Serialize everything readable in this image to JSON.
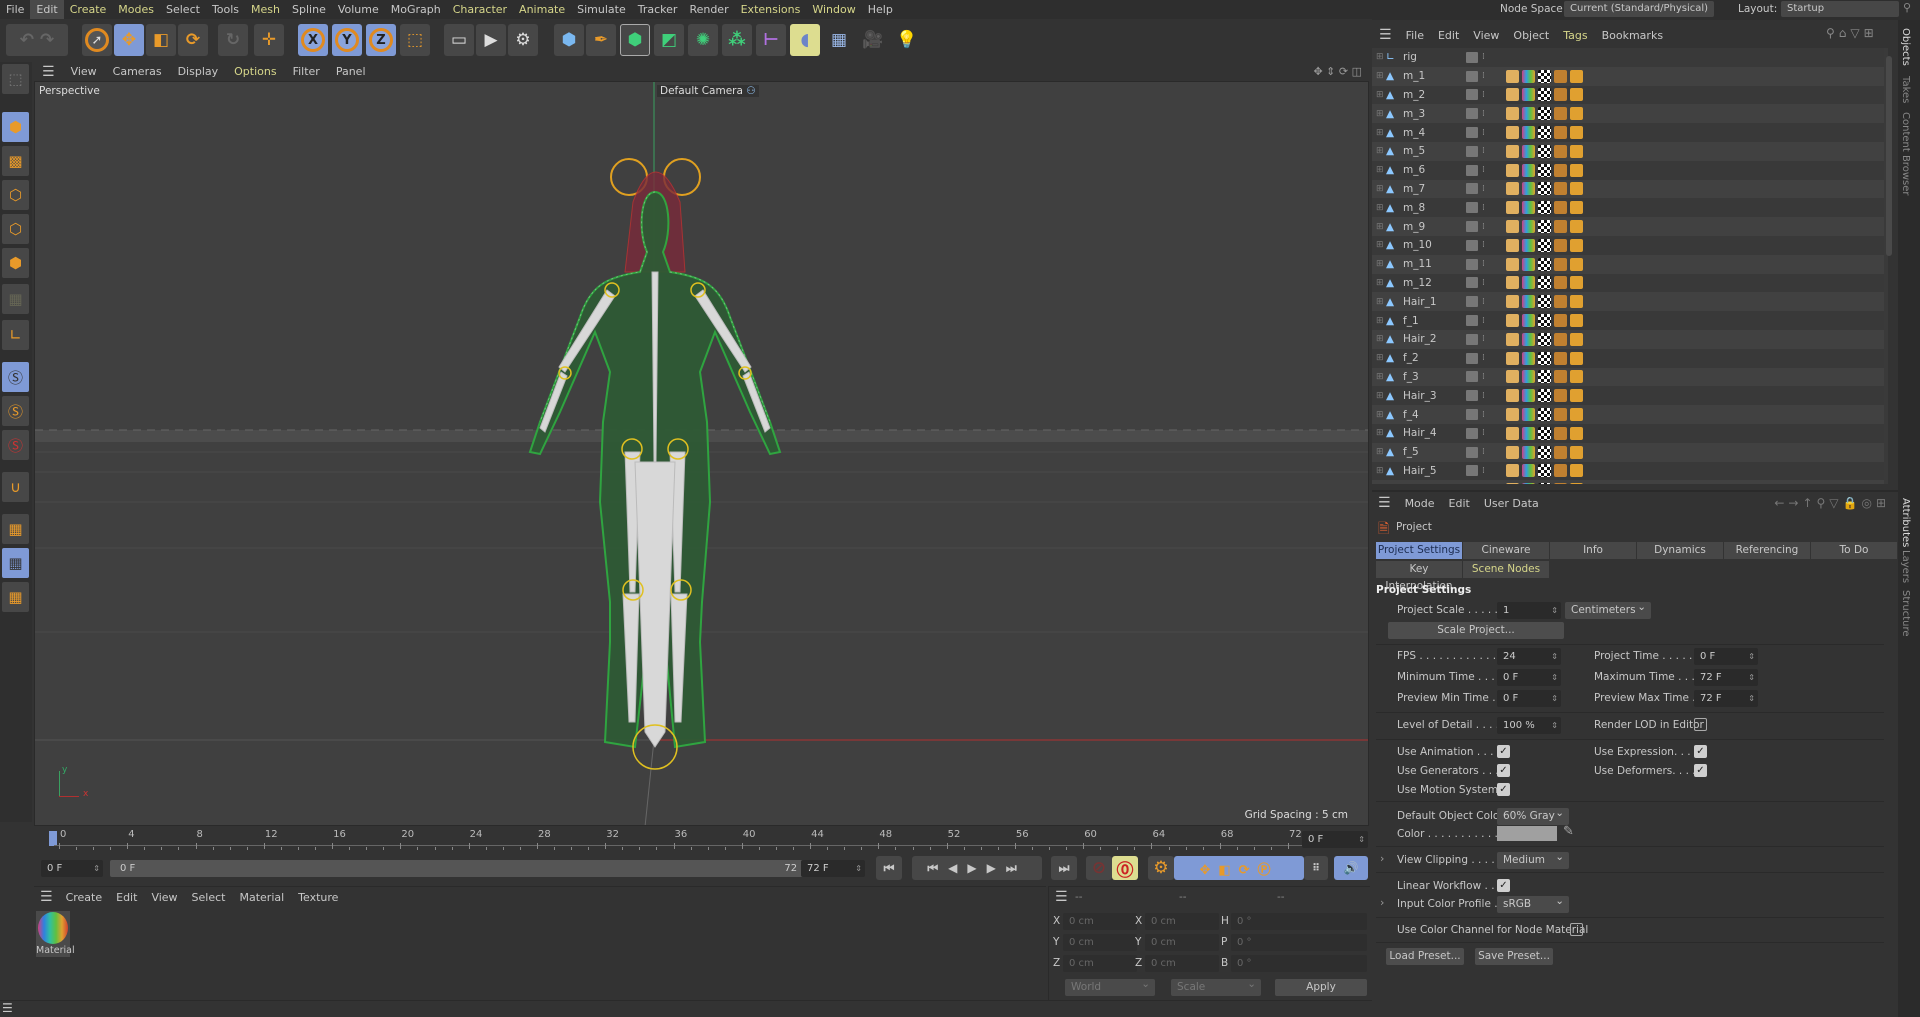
{
  "menu": [
    "File",
    "Edit",
    "Create",
    "Modes",
    "Select",
    "Tools",
    "Mesh",
    "Spline",
    "Volume",
    "MoGraph",
    "Character",
    "Animate",
    "Simulate",
    "Tracker",
    "Render",
    "Extensions",
    "Window",
    "Help"
  ],
  "top_right": {
    "node_space_label": "Node Space:",
    "node_space_value": "Current (Standard/Physical)",
    "layout_label": "Layout:",
    "layout_value": "Startup"
  },
  "viewport": {
    "menu": [
      "View",
      "Cameras",
      "Display",
      "Options",
      "Filter",
      "Panel"
    ],
    "view_name": "Perspective",
    "camera": "Default Camera",
    "grid_spacing": "Grid Spacing : 5 cm"
  },
  "timeline": {
    "ticks": [
      "0",
      "4",
      "8",
      "12",
      "16",
      "20",
      "24",
      "28",
      "32",
      "36",
      "40",
      "44",
      "48",
      "52",
      "56",
      "60",
      "64",
      "68",
      "72"
    ],
    "current_frame": "0 F",
    "start": "0 F",
    "range_start": "0 F",
    "range_end": "72 F",
    "end": "72 F"
  },
  "material_manager": {
    "menu": [
      "Create",
      "Edit",
      "View",
      "Select",
      "Material",
      "Texture"
    ],
    "materials": [
      "Material"
    ]
  },
  "coords": {
    "headers": [
      "--",
      "--",
      "--"
    ],
    "rows": [
      {
        "a": "X",
        "av": "0 cm",
        "b": "X",
        "bv": "0 cm",
        "c": "H",
        "cv": "0 °"
      },
      {
        "a": "Y",
        "av": "0 cm",
        "b": "Y",
        "bv": "0 cm",
        "c": "P",
        "cv": "0 °"
      },
      {
        "a": "Z",
        "av": "0 cm",
        "b": "Z",
        "bv": "0 cm",
        "c": "B",
        "cv": "0 °"
      }
    ],
    "space": "World",
    "mode": "Scale",
    "apply": "Apply"
  },
  "object_manager": {
    "menu": [
      "File",
      "Edit",
      "View",
      "Object",
      "Tags",
      "Bookmarks"
    ],
    "objects": [
      "rig",
      "m_1",
      "m_2",
      "m_3",
      "m_4",
      "m_5",
      "m_6",
      "m_7",
      "m_8",
      "m_9",
      "m_10",
      "m_11",
      "m_12",
      "Hair_1",
      "f_1",
      "Hair_2",
      "f_2",
      "f_3",
      "Hair_3",
      "f_4",
      "Hair_4",
      "f_5",
      "Hair_5"
    ]
  },
  "side_tabs": {
    "top": [
      "Objects",
      "Takes",
      "Content Browser"
    ],
    "bottom": [
      "Attributes",
      "Layers",
      "Structure"
    ]
  },
  "attributes": {
    "menu": [
      "Mode",
      "Edit",
      "User Data"
    ],
    "object": "Project",
    "tabs": [
      "Project Settings",
      "Cineware",
      "Info",
      "Dynamics",
      "Referencing",
      "To Do",
      "Key Interpolation",
      "Scene Nodes"
    ],
    "section": "Project Settings",
    "project_scale_label": "Project Scale . . . . . .",
    "project_scale": "1",
    "units": "Centimeters",
    "scale_project": "Scale Project...",
    "fps_label": "FPS . . . . . . . . . . . . .",
    "fps": "24",
    "project_time_label": "Project Time . . . . . .",
    "project_time": "0 F",
    "min_time_label": "Minimum Time . . .",
    "min_time": "0 F",
    "max_time_label": "Maximum Time . . .",
    "max_time": "72 F",
    "prev_min_label": "Preview Min Time . .",
    "prev_min": "0 F",
    "prev_max_label": "Preview Max Time .",
    "prev_max": "72 F",
    "lod_label": "Level of Detail . . . . .",
    "lod": "100 %",
    "render_lod_label": "Render LOD in Editor",
    "use_animation": "Use Animation . . . .",
    "use_expression": "Use Expression. . . . .",
    "use_generators": "Use Generators . . .",
    "use_deformers": "Use Deformers. . . . .",
    "use_motion": "Use Motion System",
    "default_color_label": "Default Object Color",
    "default_color": "60% Gray",
    "color_label": "Color . . . . . . . . . . .",
    "color_value": "#a0a0a0",
    "view_clipping_label": "View Clipping . . . . .",
    "view_clipping": "Medium",
    "linear_workflow": "Linear Workflow . . .",
    "input_profile_label": "Input Color Profile .",
    "input_profile": "sRGB",
    "color_channel": "Use Color Channel for Node Material",
    "load_preset": "Load Preset...",
    "save_preset": "Save Preset..."
  }
}
